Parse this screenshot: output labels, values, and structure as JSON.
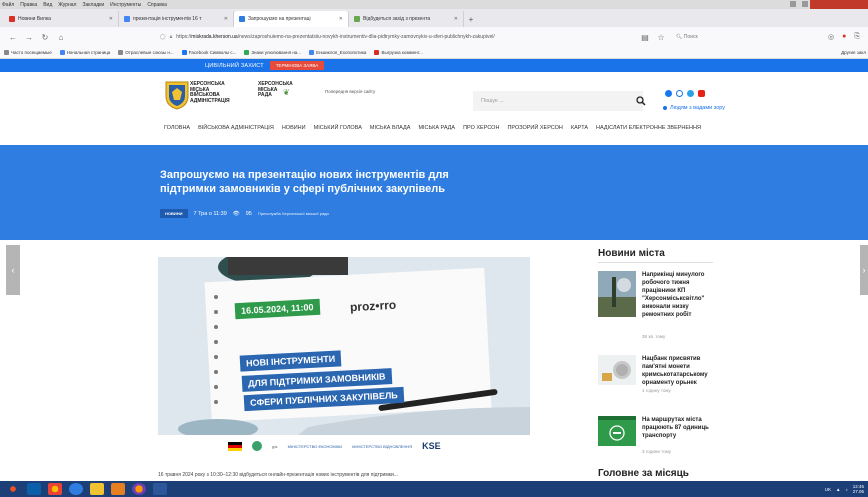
{
  "browser": {
    "menu": [
      "Файл",
      "Правка",
      "Вид",
      "Журнал",
      "Закладки",
      "Инструменты",
      "Справка"
    ],
    "tabs": [
      {
        "label": "Новини Вилка",
        "color": "#d93025",
        "active": false
      },
      {
        "label": "презентація інструментів 16 т",
        "color": "#4285f4",
        "active": false
      },
      {
        "label": "Запрошуємо на презентаці",
        "color": "#2f7de1",
        "active": true
      },
      {
        "label": "Відбудеться захід з презента",
        "color": "#6aa84f",
        "active": false
      }
    ],
    "url_prefix": "https://",
    "url_domain": "miskrada.kherson.ua",
    "url_rest": "/news/zaproshuiemo-na-prezentatsiiu-novykh-instrumentiv-dlia-pidtrymky-zamovnykiv-u-sferi-publichnykh-zakupivel/",
    "search_placeholder": "Поиск",
    "bookmarks": [
      {
        "label": "Часто посещаемые",
        "color": "#888888"
      },
      {
        "label": "Начальная страница",
        "color": "#4285f4"
      },
      {
        "label": "Отраслевые союзы н...",
        "color": "#888888"
      },
      {
        "label": "Facebook Символы с...",
        "color": "#1877f2"
      },
      {
        "label": "Знаки улюлювання на...",
        "color": "#34a853"
      },
      {
        "label": "Еншиклоп_Ехопопотика",
        "color": "#4285f4"
      },
      {
        "label": "Выгрузка коммент...",
        "color": "#d93025"
      }
    ],
    "other_bookmarks": "Другие закл"
  },
  "site": {
    "civil_defense": "ЦИВІЛЬНИЙ ЗАХИСТ",
    "terminova": "ТЕРМІНОВА ЗАЯВА",
    "logo_text_1": [
      "ХЕРСОНСЬКА",
      "МІСЬКА",
      "ВІЙСЬКОВА",
      "АДМІНІСТРАЦІЯ"
    ],
    "logo_text_2": [
      "ХЕРСОНСЬКА",
      "МІСЬКА",
      "РАДА"
    ],
    "prev_version": "Попередня версія сайту",
    "search_placeholder": "Пошук ...",
    "special_needs": "Людям з вадами зору",
    "nav": [
      "ГОЛОВНА",
      "ВІЙСЬКОВА АДМІНІСТРАЦІЯ",
      "НОВИНИ",
      "МІСЬКИЙ ГОЛОВА",
      "МІСЬКА ВЛАДА",
      "МІСЬКА РАДА",
      "ПРО ХЕРСОН",
      "ПРОЗОРИЙ ХЕРСОН",
      "КАРТА",
      "НАДІСЛАТИ ЕЛЕКТРОННЕ ЗВЕРНЕННЯ"
    ]
  },
  "article": {
    "title_line1": "Запрошуємо на презентацію  нових інструментів для",
    "title_line2": "підтримки замовників у сфері публічних закупівель",
    "badge": "НОВИНИ",
    "date": "7 Тра о 11:39",
    "views": "95",
    "source": "Пресслужба Херсонської міської ради",
    "image_date": "16.05.2024, 11:00",
    "image_brand": "proz•rro",
    "image_lines": [
      "НОВІ ІНСТРУМЕНТИ",
      "ДЛЯ ПІДТРИМКИ ЗАМОВНИКІВ",
      "СФЕРИ ПУБЛІЧНИХ ЗАКУПІВЕЛЬ"
    ],
    "partners": [
      "giz",
      "МІНІСТЕРСТВО ЕКОНОМІКИ",
      "МІНІСТЕРСТВО ВІДНОВЛЕННЯ",
      "KSE"
    ],
    "body_start": "16 травня 2024 року з 10:30–12:30 відбудеться онлайн-презентація нових інструментів для підтримки..."
  },
  "sidebar": {
    "title": "Новини міста",
    "items": [
      {
        "head": "Наприкінці минулого робочого тижня працівники КП \"Херсонміськсвітло\" виконали низку ремонтних робіт",
        "time": "38 хв. тому"
      },
      {
        "head": "Нацбанк присвятив пам'ятні монети кримськотатарському орнаменту орьнек",
        "time": "1 годину тому"
      },
      {
        "head": "На маршрутах міста працюють 87 одиниць транспорту",
        "time": "3 години тому"
      }
    ],
    "month_title": "Головне за місяць"
  },
  "taskbar": {
    "lang": "UK",
    "time": "12:45",
    "date": "27.05"
  }
}
